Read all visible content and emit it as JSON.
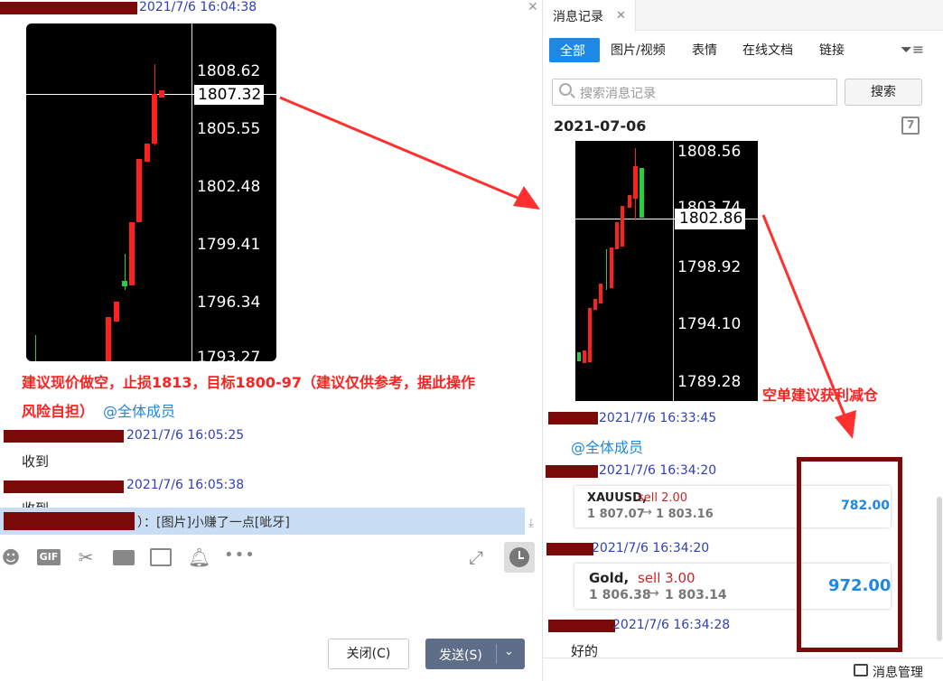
{
  "left_chat": {
    "messages": [
      {
        "timestamp": "2021/7/6 16:04:38"
      },
      {
        "text_line1": "建议现价做空，止损1813，目标1800-97（建议仅供参考，据此操作",
        "text_line2": "风险自担）",
        "mention": "@全体成员"
      },
      {
        "timestamp": "2021/7/6 16:05:25",
        "text": "收到"
      },
      {
        "timestamp": "2021/7/6 16:05:38",
        "text": "收到"
      }
    ],
    "chart": {
      "price_label": "1807.32",
      "ticks": [
        "1808.62",
        "1805.55",
        "1802.48",
        "1799.41",
        "1796.34",
        "1793.27"
      ]
    },
    "reply_bar": {
      "text": "）：[图片]小赚了一点[呲牙]"
    },
    "close_label": "关闭(C)",
    "send_label": "发送(S)"
  },
  "right_panel": {
    "title": "消息记录",
    "tabs": [
      "全部",
      "图片/视频",
      "表情",
      "在线文档",
      "链接"
    ],
    "search_placeholder": "搜索消息记录",
    "search_button": "搜索",
    "date": "2021-07-06",
    "calendar_day": "7",
    "chart": {
      "price_label": "1802.86",
      "ticks": [
        "1808.56",
        "1803.74",
        "1798.92",
        "1794.10",
        "1789.28"
      ]
    },
    "annotation": "空单建议获利减仓",
    "messages": [
      {
        "timestamp": "2021/7/6 16:33:45",
        "mention": "@全体成员"
      },
      {
        "timestamp": "2021/7/6 16:34:20"
      },
      {
        "timestamp": "2021/7/6 16:34:20"
      },
      {
        "timestamp": "2021/7/6 16:34:28",
        "text": "好的"
      }
    ],
    "trades": [
      {
        "symbol": "XAUUSD,",
        "side": "sell 2.00",
        "open": "1 807.07",
        "close": "1 803.16",
        "profit": "782.00"
      },
      {
        "symbol": "Gold,",
        "side": "sell 3.00",
        "open": "1 806.38",
        "close": "1 803.14",
        "profit": "972.00"
      }
    ],
    "manage_label": "消息管理",
    "colors": {
      "accent": "#1e88e5",
      "annotation": "#ff2020",
      "box": "#7b0a0a"
    }
  }
}
